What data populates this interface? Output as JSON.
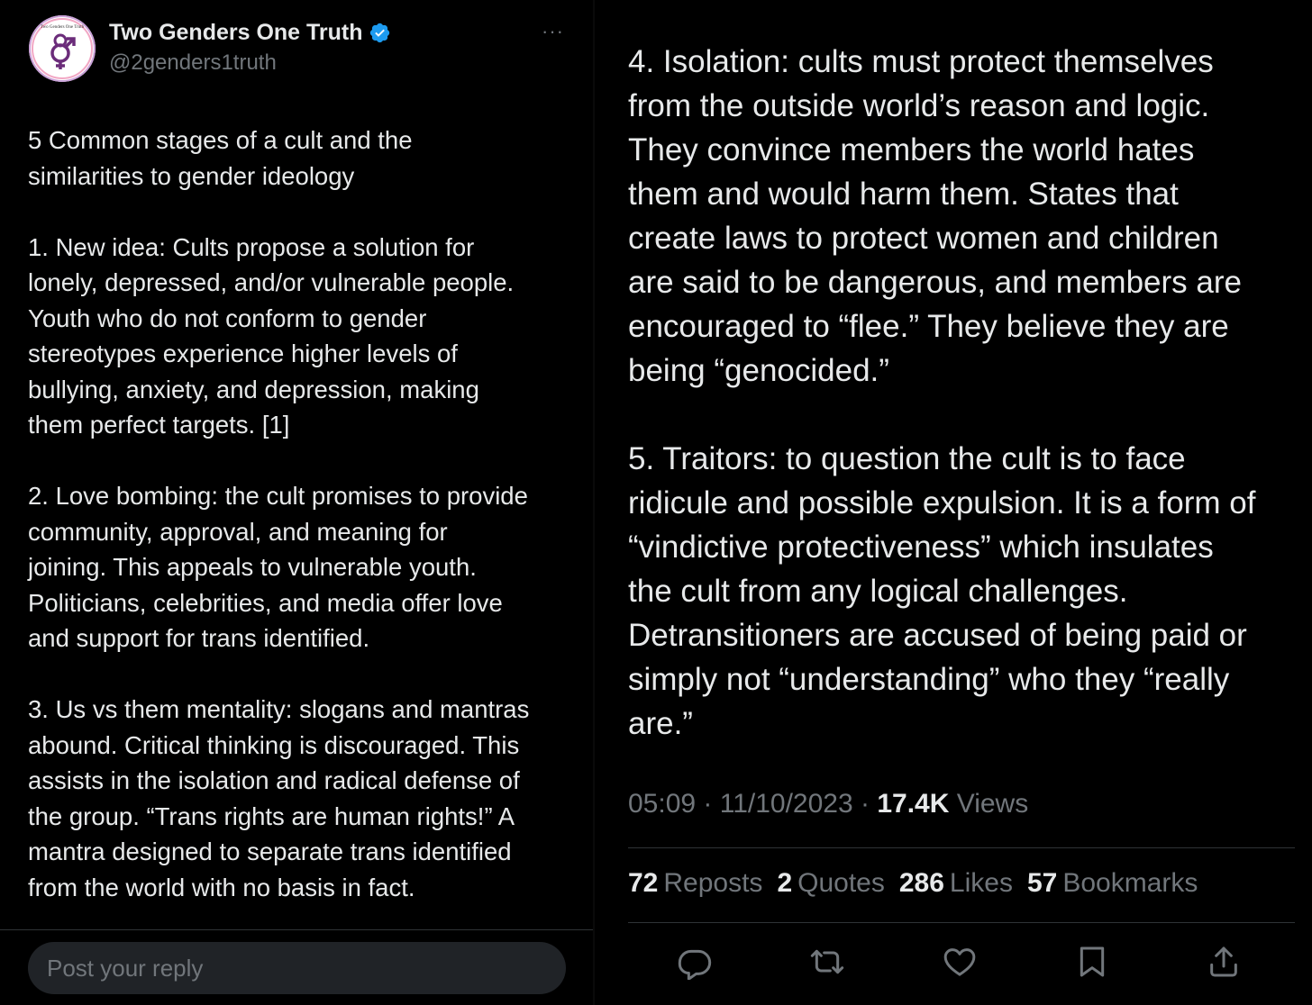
{
  "profile": {
    "display_name": "Two Genders One Truth",
    "handle": "@2genders1truth",
    "avatar_text": "Two Genders One Truth",
    "more_label": "···"
  },
  "tweet": {
    "left_text": "5 Common stages of a cult and the\nsimilarities to gender ideology\n\n1. New idea: Cults propose a solution for\nlonely, depressed, and/or vulnerable people.\nYouth who do not conform to gender\nstereotypes experience higher levels of\nbullying, anxiety, and depression, making\nthem perfect targets. [1]\n\n2. Love bombing: the cult promises to provide\ncommunity, approval, and meaning for\njoining. This appeals to vulnerable youth.\nPoliticians, celebrities, and media offer love\nand support for trans identified.\n\n3. Us vs them mentality: slogans and mantras\nabound. Critical thinking is discouraged. This\nassists in the isolation and radical defense of\nthe group. “Trans rights are human rights!” A\nmantra designed to separate trans identified\nfrom the world with no basis in fact.",
    "right_text": "4. Isolation: cults must protect themselves\nfrom the outside world’s reason and logic.\nThey convince members the world hates\nthem and would harm them. States that\ncreate laws to protect women and children\nare said to be dangerous, and members are\nencouraged to “flee.” They believe they are\nbeing “genocided.”\n\n5. Traitors: to question the cult is to face\nridicule and possible expulsion. It is a form of\n“vindictive protectiveness” which insulates\nthe cult from any logical challenges.\nDetransitioners are accused of being paid or\nsimply not “understanding” who they “really\nare.”"
  },
  "meta": {
    "time": "05:09",
    "sep": " · ",
    "date": "11/10/2023",
    "views_count": "17.4K",
    "views_label": " Views"
  },
  "stats": {
    "reposts_count": "72",
    "reposts_label": "Reposts",
    "quotes_count": "2",
    "quotes_label": "Quotes",
    "likes_count": "286",
    "likes_label": "Likes",
    "bookmarks_count": "57",
    "bookmarks_label": "Bookmarks"
  },
  "reply": {
    "placeholder": "Post your reply"
  },
  "colors": {
    "background": "#000000",
    "text": "#e7e9ea",
    "secondary": "#71767b",
    "verified": "#1d9bf0",
    "divider": "#2f3336"
  },
  "icons": {
    "verified": "verified-badge-icon",
    "reply": "reply-bubble-icon",
    "repost": "repost-arrows-icon",
    "like": "heart-icon",
    "bookmark": "bookmark-icon",
    "share": "share-upload-icon"
  }
}
